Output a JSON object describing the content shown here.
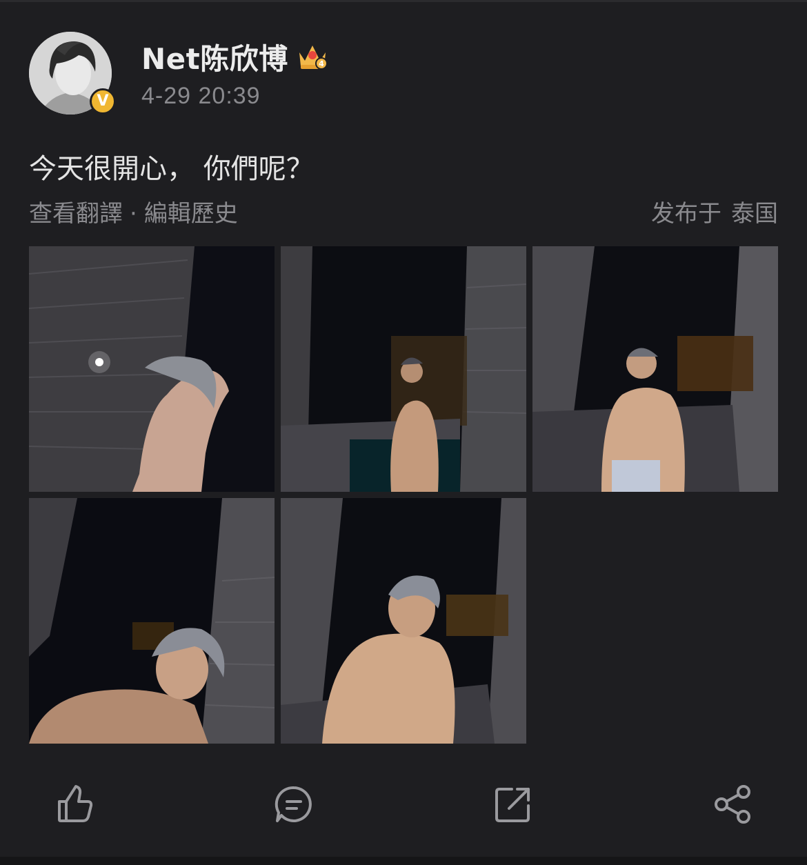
{
  "post": {
    "author": "Net陈欣博",
    "verified_badge": "V",
    "timestamp": "4-29 20:39",
    "text": "今天很開心， 你們呢？",
    "view_translation": "查看翻譯",
    "separator": "·",
    "edit_history": "編輯歷史",
    "published_prefix": "发布于",
    "location": "泰国",
    "photo_count": 5
  },
  "icons": {
    "crown": "crown-level-4-icon",
    "like": "thumbs-up-icon",
    "comment": "comment-icon",
    "repost": "repost-icon",
    "share": "share-icon"
  },
  "colors": {
    "background": "#1e1e21",
    "text_primary": "#e8e8e8",
    "text_secondary": "#8a8a8e",
    "badge": "#f0b732",
    "icon": "#9a9a9e"
  }
}
